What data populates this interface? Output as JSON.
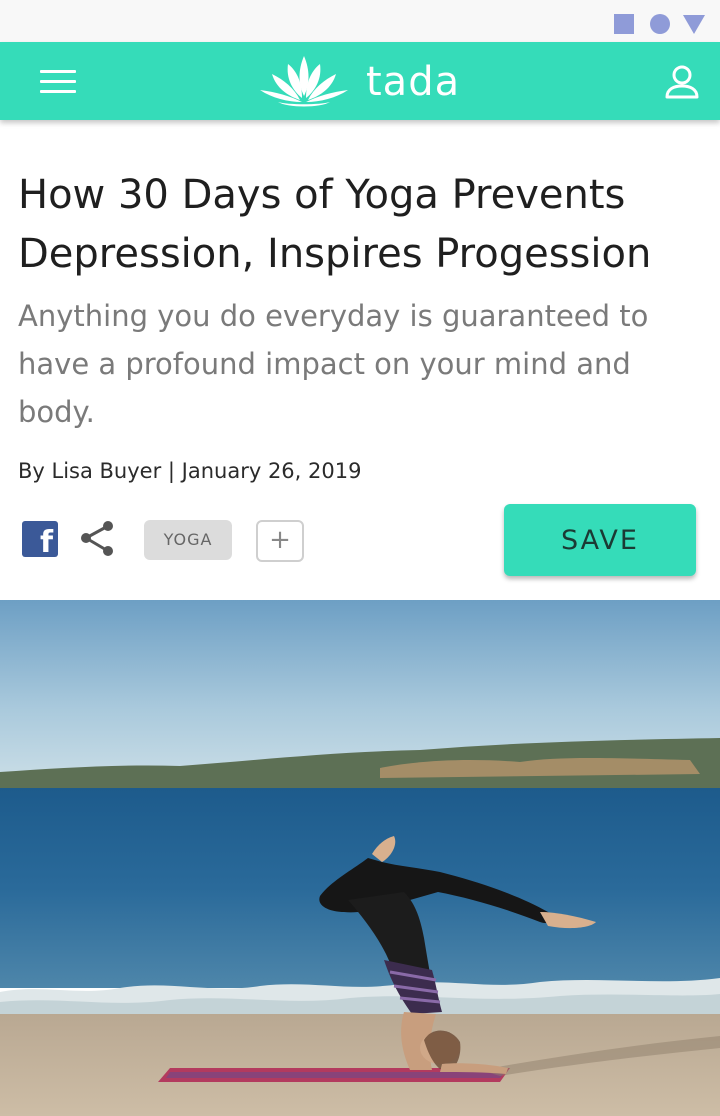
{
  "app": {
    "name": "tada",
    "brand_color": "#35dcb9",
    "icons": {
      "menu": "hamburger-menu-icon",
      "logo": "lotus-logo-icon",
      "account": "user-account-icon",
      "facebook": "facebook-icon",
      "share": "share-icon",
      "add": "plus-icon"
    }
  },
  "article": {
    "title": "How 30 Days of Yoga Prevents Depression, Inspires Progession",
    "subtitle": "Anything you do everyday is guaranteed to have a profound impact on your mind and body.",
    "byline": "By Lisa Buyer | January 26, 2019",
    "tags": [
      "YOGA"
    ],
    "add_tag_label": "+",
    "save_label": "SAVE",
    "facebook_glyph": "f"
  }
}
